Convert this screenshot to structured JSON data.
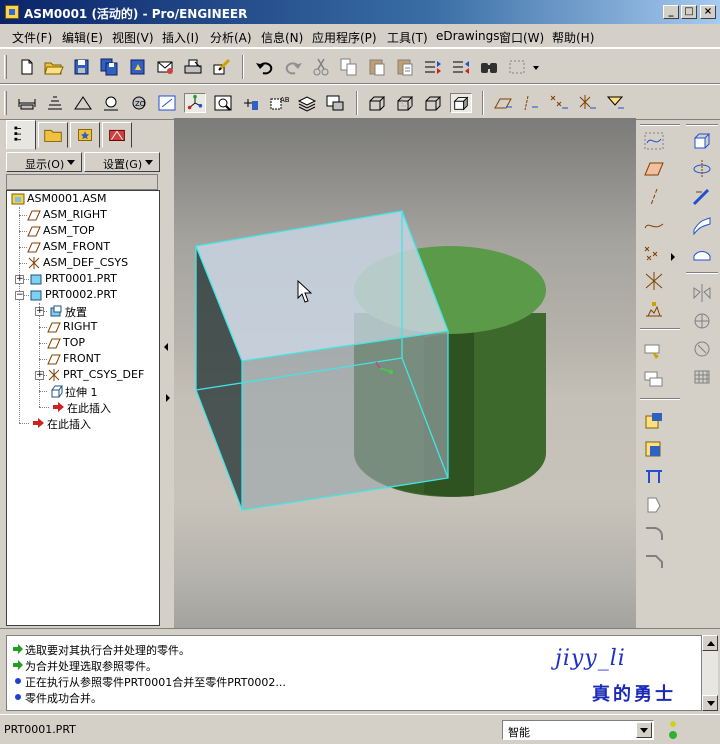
{
  "window": {
    "title": "ASM0001 (活动的) - Pro/ENGINEER"
  },
  "menubar": {
    "items": [
      "文件(F)",
      "编辑(E)",
      "视图(V)",
      "插入(I)",
      "分析(A)",
      "信息(N)",
      "应用程序(P)",
      "工具(T)",
      "eDrawings",
      "窗口(W)",
      "帮助(H)"
    ]
  },
  "panel": {
    "show_label": "显示(O)",
    "settings_label": "设置(G)"
  },
  "tree": {
    "items": [
      {
        "label": "ASM0001.ASM",
        "icon": "assembly-icon"
      },
      {
        "label": "ASM_RIGHT",
        "icon": "datum-plane-icon"
      },
      {
        "label": "ASM_TOP",
        "icon": "datum-plane-icon"
      },
      {
        "label": "ASM_FRONT",
        "icon": "datum-plane-icon"
      },
      {
        "label": "ASM_DEF_CSYS",
        "icon": "csys-icon"
      },
      {
        "label": "PRT0001.PRT",
        "icon": "part-icon"
      },
      {
        "label": "PRT0002.PRT",
        "icon": "part-icon"
      },
      {
        "label": "放置",
        "icon": "placement-icon"
      },
      {
        "label": "RIGHT",
        "icon": "datum-plane-icon"
      },
      {
        "label": "TOP",
        "icon": "datum-plane-icon"
      },
      {
        "label": "FRONT",
        "icon": "datum-plane-icon"
      },
      {
        "label": "PRT_CSYS_DEF",
        "icon": "csys-icon"
      },
      {
        "label": "拉伸 1",
        "icon": "extrude-icon"
      },
      {
        "label": "在此插入",
        "icon": "insert-here-arrow-icon"
      },
      {
        "label": "在此插入",
        "icon": "insert-here-arrow-icon"
      }
    ]
  },
  "messages": [
    {
      "text": "选取要对其执行合并处理的零件。",
      "icon": "prompt-arrow-icon"
    },
    {
      "text": "为合并处理选取参照零件。",
      "icon": "prompt-arrow-icon"
    },
    {
      "text": "正在执行从参照零件PRT0001合并至零件PRT0002...",
      "icon": "info-dot-icon"
    },
    {
      "text": "零件成功合并。",
      "icon": "info-dot-icon"
    }
  ],
  "watermark": {
    "line1": "jiyy_li",
    "line2": "真的勇士"
  },
  "status": {
    "text": "PRT0001.PRT",
    "filter_value": "智能"
  },
  "colors": {
    "titlebar": "#0a246a",
    "cylinder": "#4e8a3e",
    "selection_edge": "#40e0e0",
    "message_text_blue": "#1a2ab8"
  }
}
